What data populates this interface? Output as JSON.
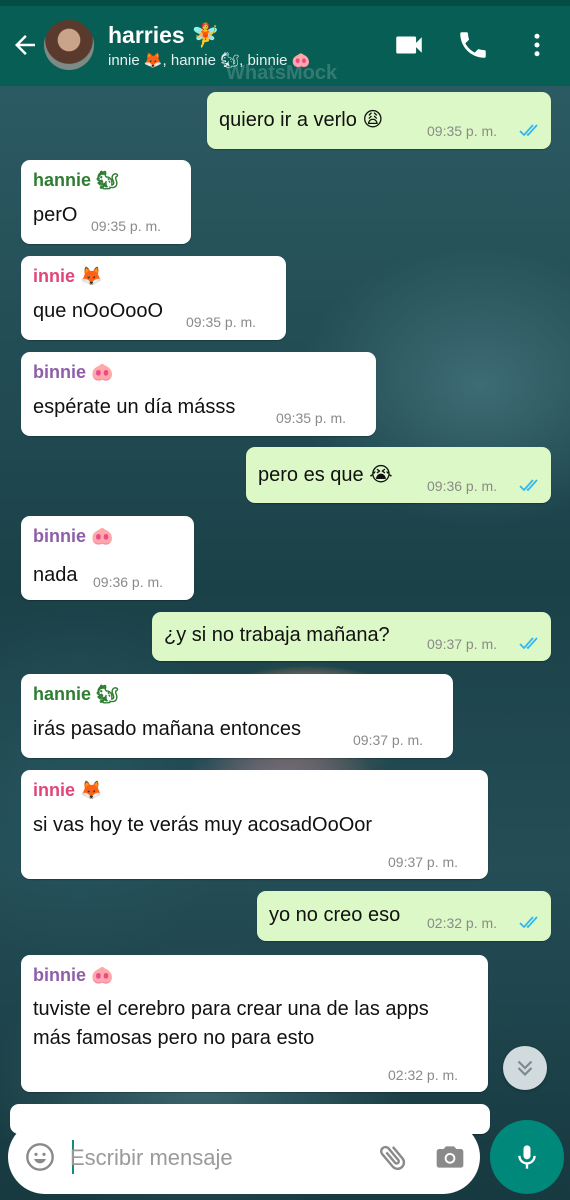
{
  "header": {
    "title": "harries 🧚",
    "subtitle": "innie 🦊, hannie 🐿, binnie 🐽",
    "watermark": "WhatsMock"
  },
  "colors": {
    "header": "#075e54",
    "incoming": "#ffffff",
    "outgoing": "#dcf8c6",
    "hannie": "#2e7d32",
    "innie": "#e0457b",
    "binnie": "#8e5fa8",
    "tick": "#34b7f1",
    "mic": "#00897b"
  },
  "messages": [
    {
      "dir": "out",
      "text": "quiero ir a verlo 😩",
      "time": "09:35 p. m."
    },
    {
      "dir": "in",
      "sender": "hannie 🐿",
      "text": "perO",
      "time": "09:35 p. m."
    },
    {
      "dir": "in",
      "sender": "innie 🦊",
      "text": "que nOoOooO",
      "time": "09:35 p. m."
    },
    {
      "dir": "in",
      "sender": "binnie 🐽",
      "text": "espérate un día másss",
      "time": "09:35 p. m."
    },
    {
      "dir": "out",
      "text": "pero es que 😭",
      "time": "09:36 p. m."
    },
    {
      "dir": "in",
      "sender": "binnie 🐽",
      "text": "nada",
      "time": "09:36 p. m."
    },
    {
      "dir": "out",
      "text": "¿y si no trabaja mañana?",
      "time": "09:37 p. m."
    },
    {
      "dir": "in",
      "sender": "hannie 🐿",
      "text": "irás pasado mañana entonces",
      "time": "09:37 p. m."
    },
    {
      "dir": "in",
      "sender": "innie 🦊",
      "text": "si vas hoy te verás muy acosadOoOor",
      "time": "09:37 p. m."
    },
    {
      "dir": "out",
      "text": "yo no creo eso",
      "time": "02:32 p. m."
    },
    {
      "dir": "in",
      "sender": "binnie 🐽",
      "text": "tuviste el cerebro para crear una de las apps más famosas pero no para esto",
      "time": "02:32 p. m."
    }
  ],
  "composer": {
    "placeholder": "Escribir mensaje"
  },
  "icons": [
    "back-arrow-icon",
    "video-call-icon",
    "phone-icon",
    "more-vert-icon",
    "emoji-icon",
    "attach-icon",
    "camera-icon",
    "mic-icon",
    "scroll-down-icon",
    "double-check-icon"
  ]
}
